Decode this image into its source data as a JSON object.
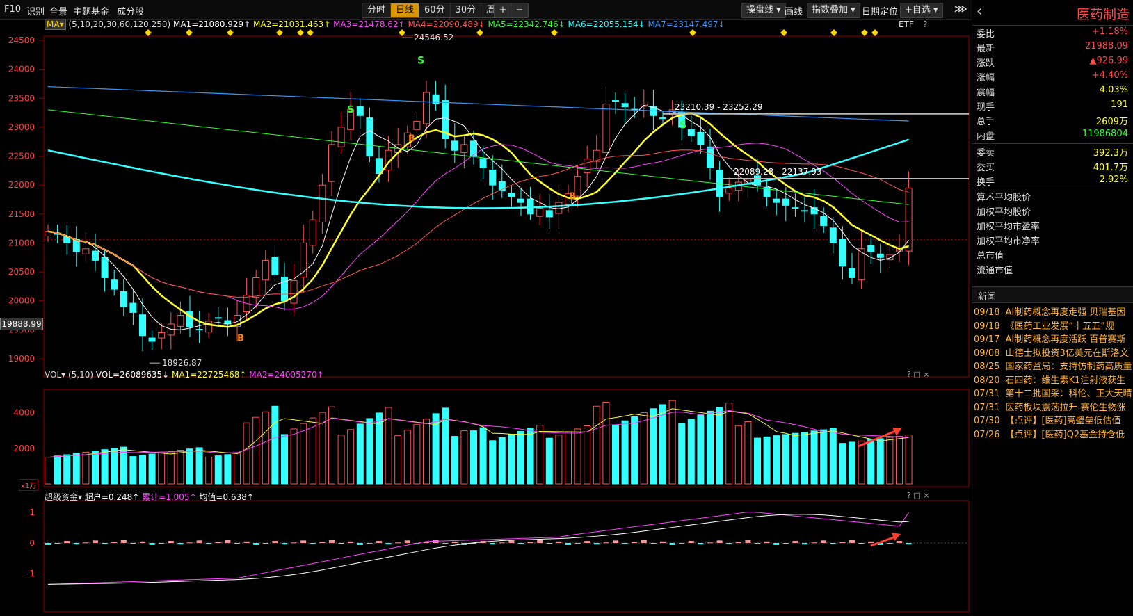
{
  "toolbar": {
    "left_links": [
      "F10",
      "识别",
      "全景",
      "主题基金",
      "成分股"
    ],
    "periods": [
      "分时",
      "日线",
      "60分",
      "30分",
      "周线 ▾"
    ],
    "active_period": "日线",
    "zoom_in": "+",
    "zoom_out": "−",
    "right_tools": [
      "操盘线 ▾",
      "画线",
      "指数叠加 ▾",
      "日期定位",
      "+自选 ▾"
    ],
    "collapse": "⋙"
  },
  "main_chart": {
    "indicator_label": "MA▾",
    "params": "(5,10,20,30,60,120,250)",
    "ma_readouts": [
      {
        "text": "MA1=21080.929↑",
        "color": "#ffffff"
      },
      {
        "text": "MA2=21031.463↑",
        "color": "#ffff33"
      },
      {
        "text": "MA3=21478.62↑",
        "color": "#ff44ff"
      },
      {
        "text": "MA4=22090.489↓",
        "color": "#ff5555"
      },
      {
        "text": "MA5=22342.746↓",
        "color": "#33ff33"
      },
      {
        "text": "MA6=22055.154↓",
        "color": "#33ffff"
      },
      {
        "text": "MA7=23147.497↓",
        "color": "#3399ff"
      }
    ],
    "etf_label": "ETF",
    "help": "?",
    "y_ticks": [
      "24500",
      "24000",
      "23500",
      "23000",
      "22500",
      "22000",
      "21500",
      "21000",
      "20500",
      "20000",
      "19500",
      "19000"
    ],
    "current_price_tag": "19888.99",
    "annotations": {
      "high": "24546.52",
      "low": "18926.87",
      "range1": "23210.39 - 23252.29",
      "range2": "22089.28 - 22137.93"
    },
    "signals": {
      "buy": "B",
      "sell": "S"
    }
  },
  "vol_panel": {
    "label": "VOL▾",
    "params": "(5,10)",
    "readouts": [
      {
        "text": "VOL=26089635↓",
        "color": "#ffffff"
      },
      {
        "text": "MA1=22725468↑",
        "color": "#ffff33"
      },
      {
        "text": "MA2=24005270↑",
        "color": "#ff44ff"
      }
    ],
    "y_ticks": [
      "4000",
      "2000"
    ],
    "unit": "x1万",
    "controls": "? □ ×"
  },
  "fund_panel": {
    "label": "超级资金▾",
    "readouts": [
      {
        "text": "超户=0.248↑",
        "color": "#ffffff"
      },
      {
        "text": "累计=1.005↑",
        "color": "#ff44ff"
      },
      {
        "text": "均值=0.638↑",
        "color": "#ffffff"
      }
    ],
    "y_ticks": [
      "1",
      "0",
      "-1"
    ],
    "controls": "? □ ×"
  },
  "quote": {
    "back_icon": "‹",
    "name": "医药制造",
    "rows": [
      {
        "k": "委比",
        "v": "+1.18%",
        "color": "#ff4a4a"
      },
      {
        "k": "最新",
        "v": "21988.09",
        "color": "#ff4a4a"
      },
      {
        "k": "涨跌",
        "v": "▲926.99",
        "color": "#ff4a4a"
      },
      {
        "k": "涨幅",
        "v": "+4.40%",
        "color": "#ff4a4a"
      },
      {
        "k": "震幅",
        "v": "4.03%",
        "color": "#ffff33"
      },
      {
        "k": "现手",
        "v": "191",
        "color": "#ffff33"
      },
      {
        "k": "总手",
        "v": "2609万",
        "color": "#ffff33"
      },
      {
        "k": "内盘",
        "v": "11986804",
        "color": "#33ff33"
      },
      {
        "k": "委卖",
        "v": "392.3万",
        "color": "#ffff33"
      },
      {
        "k": "委买",
        "v": "401.7万",
        "color": "#ffff33"
      },
      {
        "k": "换手",
        "v": "2.92%",
        "color": "#ffff33"
      }
    ],
    "metrics": [
      "算术平均股价",
      "加权平均股价",
      "加权平均市盈率",
      "加权平均市净率",
      "总市值",
      "流通市值"
    ]
  },
  "news": {
    "title": "新闻",
    "items": [
      {
        "date": "09/18",
        "text": "AI制药概念再度走强 贝瑞基因"
      },
      {
        "date": "09/18",
        "text": "《医药工业发展“十五五”规"
      },
      {
        "date": "09/17",
        "text": "AI制药概念再度活跃 百普赛斯"
      },
      {
        "date": "09/08",
        "text": "山德士拟投资3亿美元在斯洛文"
      },
      {
        "date": "08/25",
        "text": "国家药监局：支持仿制药高质量"
      },
      {
        "date": "08/20",
        "text": "石四药：维生素K1注射液获生"
      },
      {
        "date": "07/31",
        "text": "第十二批国采：科伦、正大天晴"
      },
      {
        "date": "07/31",
        "text": "医药板块震荡拉升 赛伦生物涨"
      },
      {
        "date": "07/30",
        "text": "【点评】[医药]高壁垒低估值"
      },
      {
        "date": "07/26",
        "text": "【点评】[医药]Q2基金持仓低"
      }
    ]
  }
}
